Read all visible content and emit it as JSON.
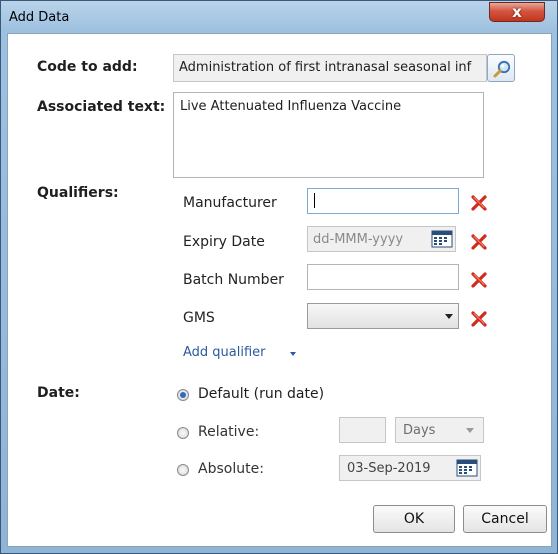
{
  "window": {
    "title": "Add Data",
    "close_glyph": "x"
  },
  "code": {
    "label": "Code to add:",
    "value": "Administration of first intranasal seasonal inf",
    "lookup_icon": "magnifier-icon"
  },
  "associated": {
    "label": "Associated text:",
    "value": "Live Attenuated Influenza Vaccine"
  },
  "qualifiers": {
    "label": "Qualifiers:",
    "items": [
      {
        "label": "Manufacturer",
        "value": ""
      },
      {
        "label": "Expiry Date",
        "placeholder": "dd-MMM-yyyy"
      },
      {
        "label": "Batch Number",
        "value": ""
      },
      {
        "label": "GMS",
        "value": ""
      }
    ],
    "add_link": "Add qualifier",
    "remove_icon": "red-x-icon",
    "remove_color": "#d42a1a"
  },
  "date": {
    "label": "Date:",
    "options": [
      {
        "label": "Default (run date)",
        "selected": true
      },
      {
        "label": "Relative:",
        "selected": false
      },
      {
        "label": "Absolute:",
        "selected": false
      }
    ],
    "relative_value": "",
    "relative_unit": "Days",
    "absolute_value": "03-Sep-2019"
  },
  "buttons": {
    "ok": "OK",
    "cancel": "Cancel"
  }
}
